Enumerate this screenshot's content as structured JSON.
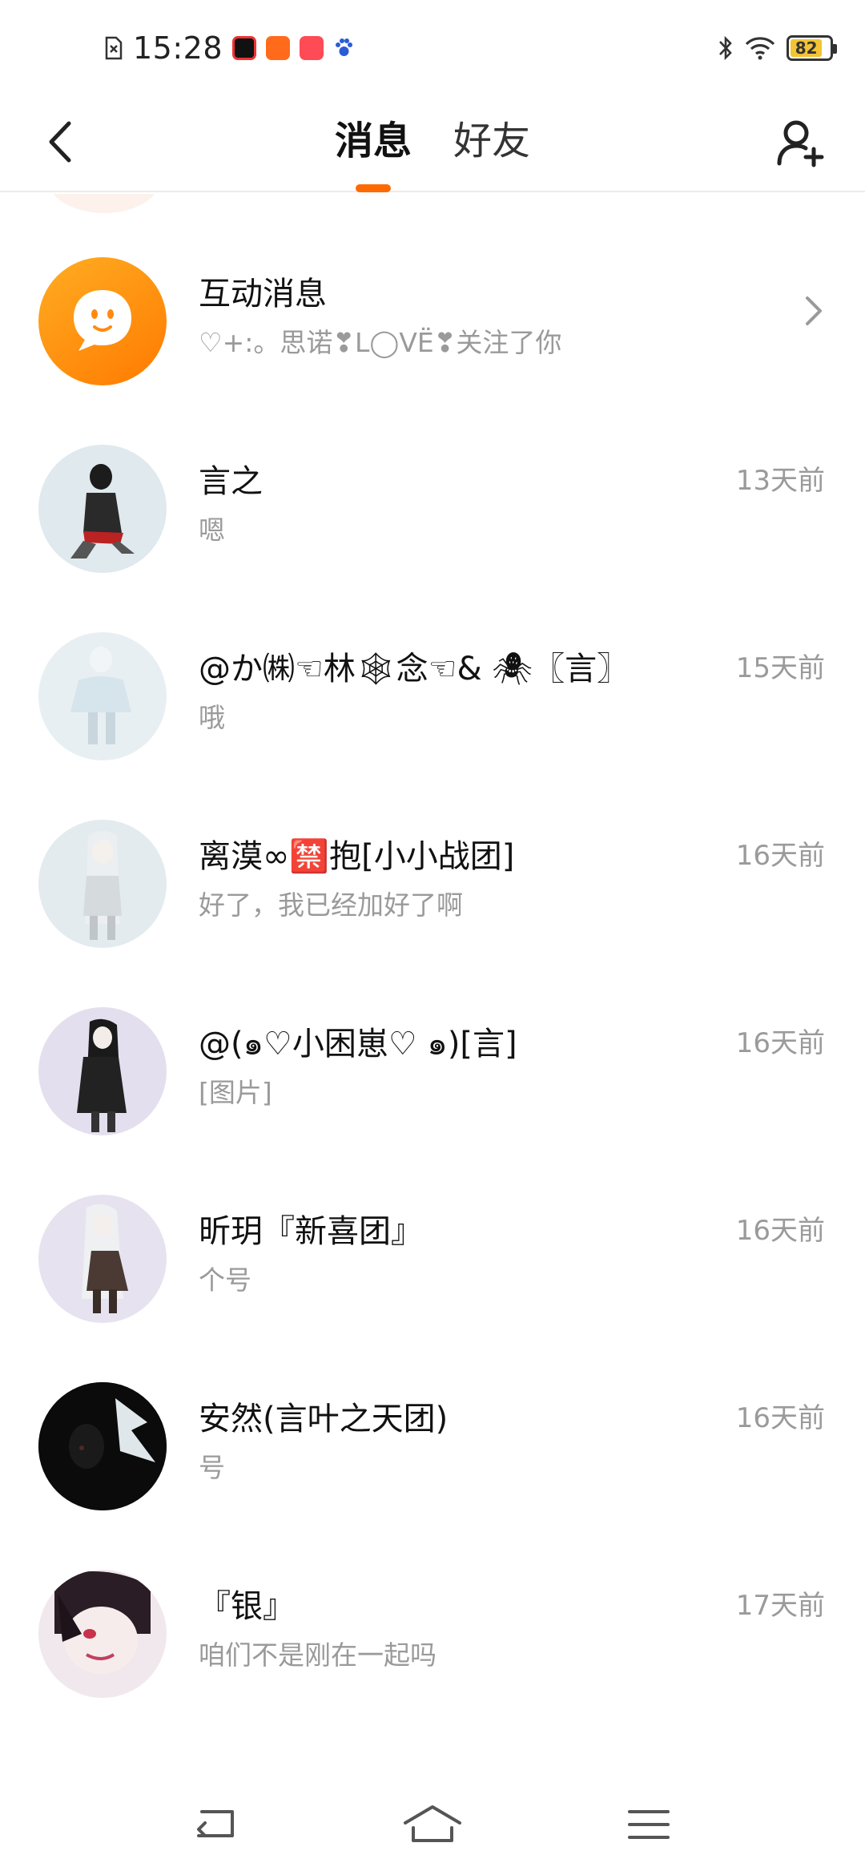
{
  "status_bar": {
    "time": "15:28",
    "battery": "82",
    "icons": [
      "sim-card-icon",
      "video-app-icon",
      "taobao-app-icon",
      "kuaishou-app-icon",
      "baidu-paw-icon",
      "bluetooth-icon",
      "wifi-icon",
      "battery-icon"
    ]
  },
  "header": {
    "tabs": [
      {
        "label": "消息",
        "active": true
      },
      {
        "label": "好友",
        "active": false
      }
    ]
  },
  "messages": [
    {
      "name": "互动消息",
      "preview": "♡+:。思诺❣L◯VË❣关注了你",
      "time": "",
      "type": "interaction"
    },
    {
      "name": "言之",
      "preview": "嗯",
      "time": "13天前"
    },
    {
      "name": "@か㈱☜林🕸念☜& 🕷〖言〗",
      "preview": "哦",
      "time": "15天前"
    },
    {
      "name": "离漠∞🈲抱[小小战团]",
      "preview": "好了，我已经加好了啊",
      "time": "16天前"
    },
    {
      "name": "@(๑♡小困崽♡ ๑)[言]",
      "preview": "[图片]",
      "time": "16天前"
    },
    {
      "name": "昕玥『新喜团』",
      "preview": "个号",
      "time": "16天前"
    },
    {
      "name": "安然(言叶之天团)",
      "preview": "号",
      "time": "16天前"
    },
    {
      "name": "『银』",
      "preview": "咱们不是刚在一起吗",
      "time": "17天前"
    }
  ],
  "colors": {
    "accent": "#ff6a00",
    "interaction_avatar": "#ff8a0f",
    "secondary_text": "#9a9a9a"
  }
}
